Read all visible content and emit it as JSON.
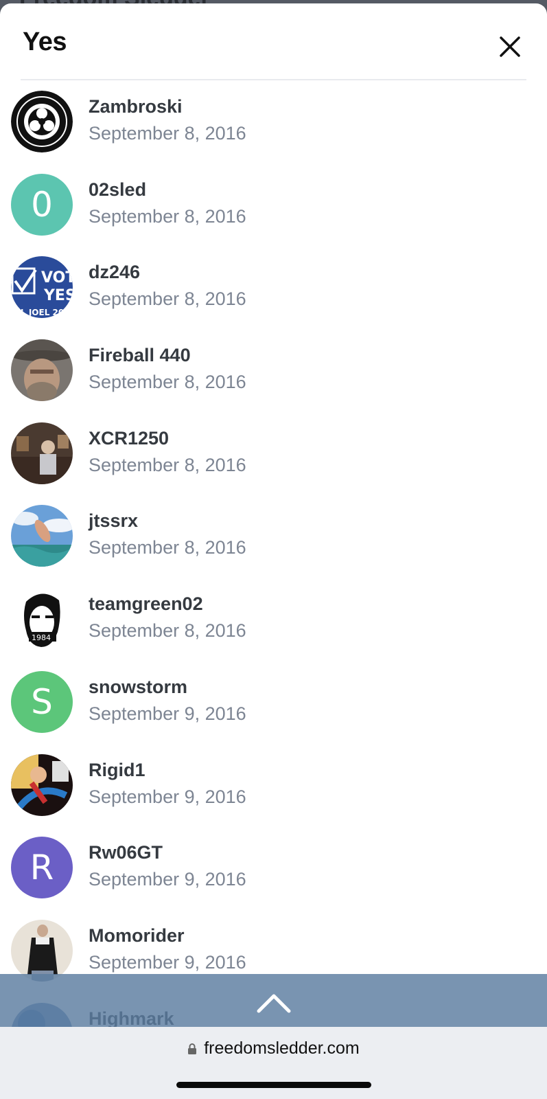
{
  "sheet": {
    "title": "Yes",
    "close_icon": "close-icon"
  },
  "users": [
    {
      "name": "Zambroski",
      "date": "September 8, 2016",
      "avatar": {
        "type": "image",
        "kind": "biohazard-badge"
      }
    },
    {
      "name": "02sled",
      "date": "September 8, 2016",
      "avatar": {
        "type": "letter",
        "letter": "0",
        "color": "#5cc5b0"
      }
    },
    {
      "name": "dz246",
      "date": "September 8, 2016",
      "avatar": {
        "type": "image",
        "kind": "vote-yes-badge"
      }
    },
    {
      "name": "Fireball 440",
      "date": "September 8, 2016",
      "avatar": {
        "type": "image",
        "kind": "portrait-hat"
      }
    },
    {
      "name": "XCR1250",
      "date": "September 8, 2016",
      "avatar": {
        "type": "image",
        "kind": "room-photo"
      }
    },
    {
      "name": "jtssrx",
      "date": "September 8, 2016",
      "avatar": {
        "type": "image",
        "kind": "water-jump"
      }
    },
    {
      "name": "teamgreen02",
      "date": "September 8, 2016",
      "avatar": {
        "type": "image",
        "kind": "orwell-1984"
      }
    },
    {
      "name": "snowstorm",
      "date": "September 9, 2016",
      "avatar": {
        "type": "letter",
        "letter": "S",
        "color": "#5cc67a"
      }
    },
    {
      "name": "Rigid1",
      "date": "September 9, 2016",
      "avatar": {
        "type": "image",
        "kind": "cartoon-art"
      }
    },
    {
      "name": "Rw06GT",
      "date": "September 9, 2016",
      "avatar": {
        "type": "letter",
        "letter": "R",
        "color": "#6b5fc6"
      }
    },
    {
      "name": "Momorider",
      "date": "September 9, 2016",
      "avatar": {
        "type": "image",
        "kind": "painting-figure"
      }
    },
    {
      "name": "Highmark",
      "date": "",
      "avatar": {
        "type": "image",
        "kind": "partial-blue"
      }
    }
  ],
  "scroll_top": {
    "icon": "chevron-up-icon"
  },
  "browser": {
    "url": "freedomsledder.com",
    "lock_icon": "lock-icon"
  },
  "colors": {
    "name_text": "#353a40",
    "date_text": "#7d8593",
    "scroll_bar": "#5c7da0"
  }
}
